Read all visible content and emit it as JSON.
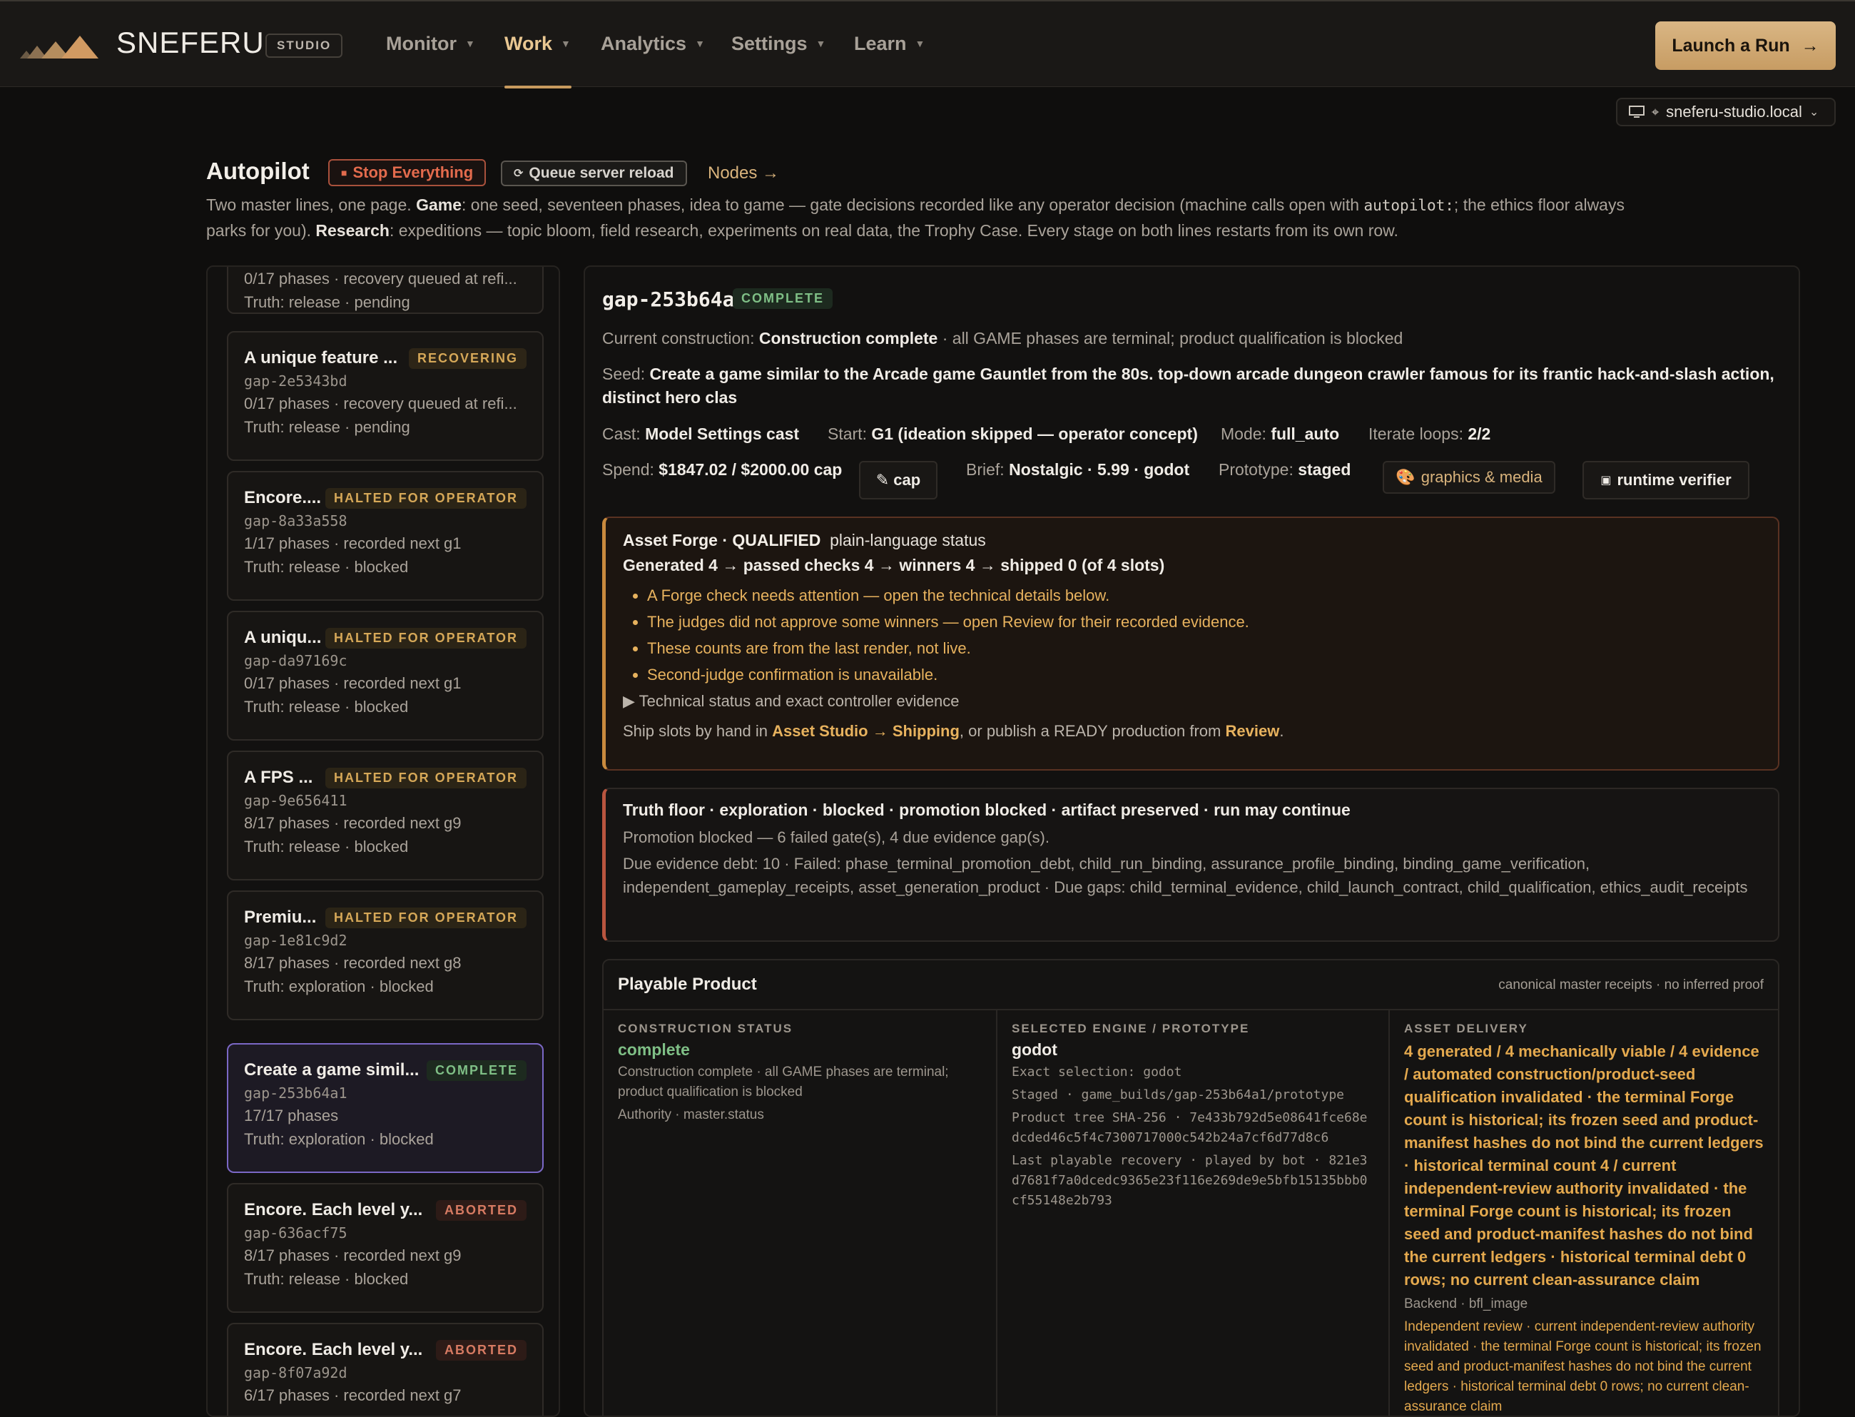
{
  "colors": {
    "accent": "#c79a5e",
    "amber": "#e7b25e",
    "danger": "#e36b4d",
    "success": "#7fbf86",
    "selected_border": "#7b68c6"
  },
  "header": {
    "brand": "SNEFERU",
    "studio": "STUDIO",
    "nav": [
      {
        "label": "Monitor",
        "active": false
      },
      {
        "label": "Work",
        "active": true
      },
      {
        "label": "Analytics",
        "active": false
      },
      {
        "label": "Settings",
        "active": false
      },
      {
        "label": "Learn",
        "active": false
      }
    ],
    "launch": "Launch a Run",
    "host": "sneferu-studio.local"
  },
  "page": {
    "title": "Autopilot",
    "stop": "Stop Everything",
    "reload": "Queue server reload",
    "nodes": "Nodes →",
    "intro_a": "Two master lines, one page. ",
    "intro_game": "Game",
    "intro_b": ": one seed, seventeen phases, idea to game — gate decisions recorded like any operator decision (machine calls open with ",
    "intro_code": "autopilot:",
    "intro_c": "; the ethics floor always parks for you). ",
    "intro_research": "Research",
    "intro_d": ": expeditions — topic bloom, field research, experiments on real data, the Trophy Case. Every stage on both lines restarts from its own row."
  },
  "runs": [
    {
      "title": "",
      "badge": "",
      "id": "",
      "line1": "0/17 phases · recovery queued at refi...",
      "line2": "Truth: release · pending"
    },
    {
      "title": "A unique feature ...",
      "badge": "RECOVERING",
      "id": "gap-2e5343bd",
      "line1": "0/17 phases · recovery queued at refi...",
      "line2": "Truth: release · pending"
    },
    {
      "title": "Encore....",
      "badge": "HALTED FOR OPERATOR",
      "id": "gap-8a33a558",
      "line1": "1/17 phases · recorded next g1",
      "line2": "Truth: release · blocked"
    },
    {
      "title": "A uniqu...",
      "badge": "HALTED FOR OPERATOR",
      "id": "gap-da97169c",
      "line1": "0/17 phases · recorded next g1",
      "line2": "Truth: release · blocked"
    },
    {
      "title": "A FPS ...",
      "badge": "HALTED FOR OPERATOR",
      "id": "gap-9e656411",
      "line1": "8/17 phases · recorded next g9",
      "line2": "Truth: release · blocked"
    },
    {
      "title": "Premiu...",
      "badge": "HALTED FOR OPERATOR",
      "id": "gap-1e81c9d2",
      "line1": "8/17 phases · recorded next g8",
      "line2": "Truth: exploration · blocked"
    },
    {
      "title": "Create a game simil...",
      "badge": "COMPLETE",
      "id": "gap-253b64a1",
      "line1": "17/17 phases",
      "line2": "Truth: exploration · blocked"
    },
    {
      "title": "Encore. Each level y...",
      "badge": "ABORTED",
      "id": "gap-636acf75",
      "line1": "8/17 phases · recorded next g9",
      "line2": "Truth: release · blocked"
    },
    {
      "title": "Encore. Each level y...",
      "badge": "ABORTED",
      "id": "gap-8f07a92d",
      "line1": "6/17 phases · recorded next g7",
      "line2": ""
    }
  ],
  "detail": {
    "id": "gap-253b64a1",
    "status": "COMPLETE",
    "construction_label": "Current construction: ",
    "construction_value": "Construction complete",
    "construction_rest": " · all GAME phases are terminal; product qualification is blocked",
    "seed_label": "Seed: ",
    "seed_value": "Create a game similar to the Arcade game Gauntlet from the 80s. top-down arcade dungeon crawler famous for its frantic hack-and-slash action, distinct hero clas",
    "cast_label": "Cast: ",
    "cast_value": "Model Settings cast",
    "start_label": "Start: ",
    "start_value": "G1 (ideation skipped — operator concept)",
    "mode_label": "Mode: ",
    "mode_value": "full_auto",
    "iterate_label": "Iterate loops: ",
    "iterate_value": "2/2",
    "spend_label": "Spend: ",
    "spend_value": "$1847.02 / $2000.00 cap",
    "cap_btn": "✎ cap",
    "brief_label": "Brief: ",
    "brief_value": "Nostalgic · 5.99 · godot",
    "proto_label": "Prototype: ",
    "proto_value": "staged",
    "graphics_btn": "graphics & media",
    "verifier_btn": "runtime verifier"
  },
  "forge": {
    "title": "Asset Forge · QUALIFIED",
    "subtitle": "plain-language status",
    "generated": "Generated 4 → passed checks 4 → winners 4 → shipped 0 (of 4 slots)",
    "bullets": [
      "A Forge check needs attention — open the technical details below.",
      "The judges did not approve some winners — open Review for their recorded evidence.",
      "These counts are from the last render, not live.",
      "Second-judge confirmation is unavailable."
    ],
    "technical": "▶ Technical status and exact controller evidence",
    "ship_a": "Ship slots by hand in ",
    "ship_link1": "Asset Studio → Shipping",
    "ship_b": ", or publish a READY production from ",
    "ship_link2": "Review",
    "ship_c": "."
  },
  "truth": {
    "head": "Truth floor · exploration · blocked · promotion blocked · artifact preserved · run may continue",
    "line1": "Promotion blocked — 6 failed gate(s), 4 due evidence gap(s).",
    "line2": "Due evidence debt: 10 · Failed: phase_terminal_promotion_debt, child_run_binding, assurance_profile_binding, binding_game_verification, independent_gameplay_receipts, asset_generation_product · Due gaps: child_terminal_evidence, child_launch_contract, child_qualification, ethics_audit_receipts"
  },
  "product": {
    "title": "Playable Product",
    "note": "canonical master receipts · no inferred proof",
    "c1_label": "CONSTRUCTION STATUS",
    "c1_value": "complete",
    "c1_desc": "Construction complete · all GAME phases are terminal; product qualification is blocked",
    "c1_authority": "Authority · master.status",
    "c2_label": "SELECTED ENGINE / PROTOTYPE",
    "c2_value": "godot",
    "c2_exact": "Exact selection: godot",
    "c2_staged": "Staged · game_builds/gap-253b64a1/prototype",
    "c2_sha": "Product tree SHA-256 · 7e433b792d5e08641fce68edcded46c5f4c7300717000c542b24a7cf6d77d8c6",
    "c2_recovery": "Last playable recovery · played by bot · 821e3d7681f7a0dcedc9365e23f116e269de9e5bfb15135bbb0cf55148e2b793",
    "c3_label": "ASSET DELIVERY",
    "c3_value": "4 generated / 4 mechanically viable / 4 evidence / automated construction/product-seed qualification invalidated · the terminal Forge count is historical; its frozen seed and product-manifest hashes do not bind the current ledgers · historical terminal count 4 / current independent-review authority invalidated · the terminal Forge count is historical; its frozen seed and product-manifest hashes do not bind the current ledgers · historical terminal debt 0 rows; no current clean-assurance claim",
    "c3_backend": "Backend · bfl_image",
    "c3_review": "Independent review · current independent-review authority invalidated · the terminal Forge count is historical; its frozen seed and product-manifest hashes do not bind the current ledgers · historical terminal debt 0 rows; no current clean-assurance claim"
  }
}
